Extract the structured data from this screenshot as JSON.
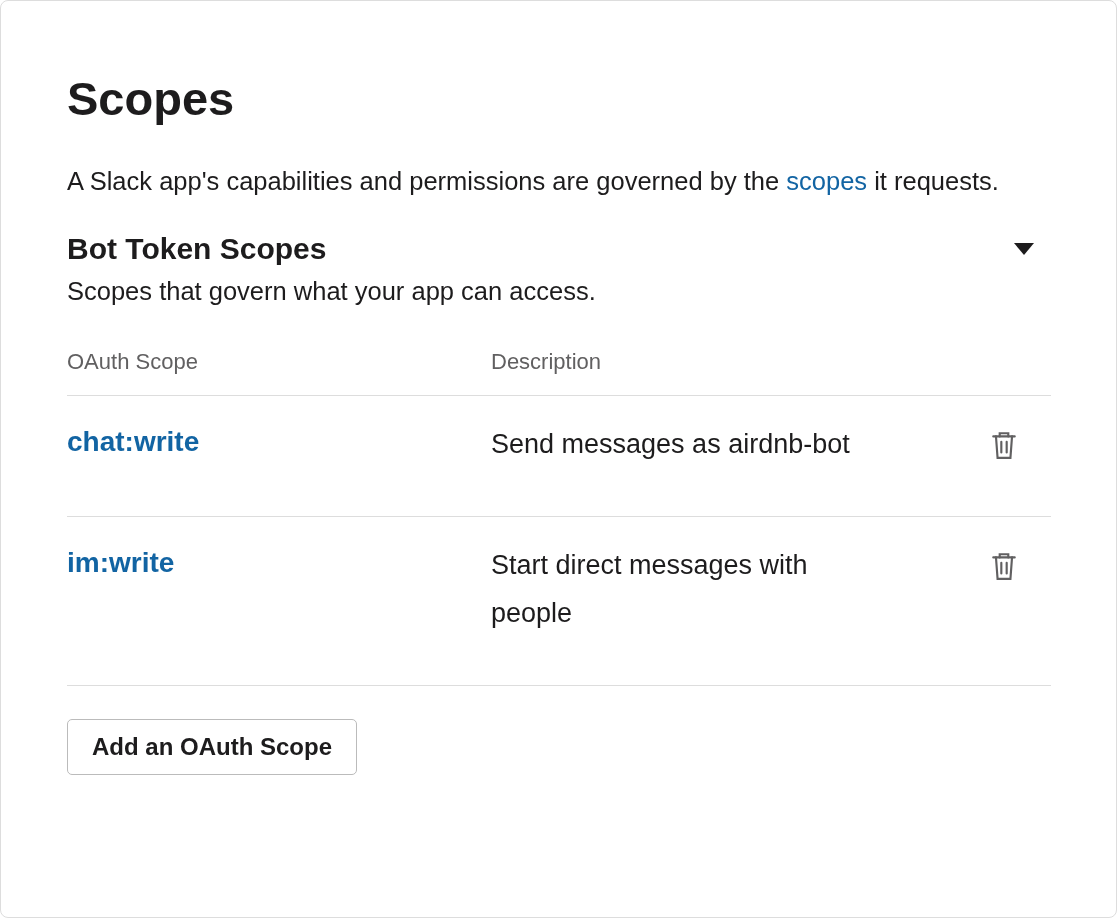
{
  "title": "Scopes",
  "intro": {
    "before": "A Slack app's capabilities and permissions are governed by the ",
    "link": "scopes",
    "after": " it requests."
  },
  "section": {
    "title": "Bot Token Scopes",
    "expanded": true,
    "subtitle": "Scopes that govern what your app can access."
  },
  "table": {
    "columns": [
      "OAuth Scope",
      "Description"
    ],
    "rows": [
      {
        "scope": "chat:write",
        "description": "Send messages as airdnb-bot"
      },
      {
        "scope": "im:write",
        "description": "Start direct messages with people"
      }
    ]
  },
  "add_button": "Add an OAuth Scope"
}
